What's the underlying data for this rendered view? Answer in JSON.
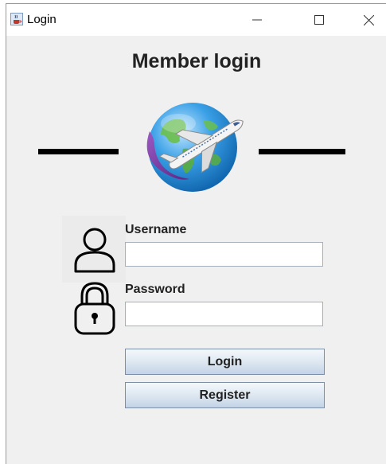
{
  "window": {
    "title": "Login",
    "app_icon": "java-cup-icon",
    "controls": [
      "minimize-icon",
      "maximize-icon",
      "close-icon"
    ]
  },
  "main": {
    "heading": "Member login",
    "logo": "globe-airplane-logo",
    "username_label": "Username",
    "username_value": "",
    "password_label": "Password",
    "password_value": "",
    "login_button": "Login",
    "register_button": "Register"
  },
  "icons": {
    "user": "user-icon",
    "lock": "lock-icon"
  },
  "colors": {
    "background": "#f0f0f0",
    "button_top": "#f4f8fc",
    "button_bottom": "#c2d3e6",
    "globe": "#2a8fd6",
    "swoosh": "#7b3fa0"
  }
}
